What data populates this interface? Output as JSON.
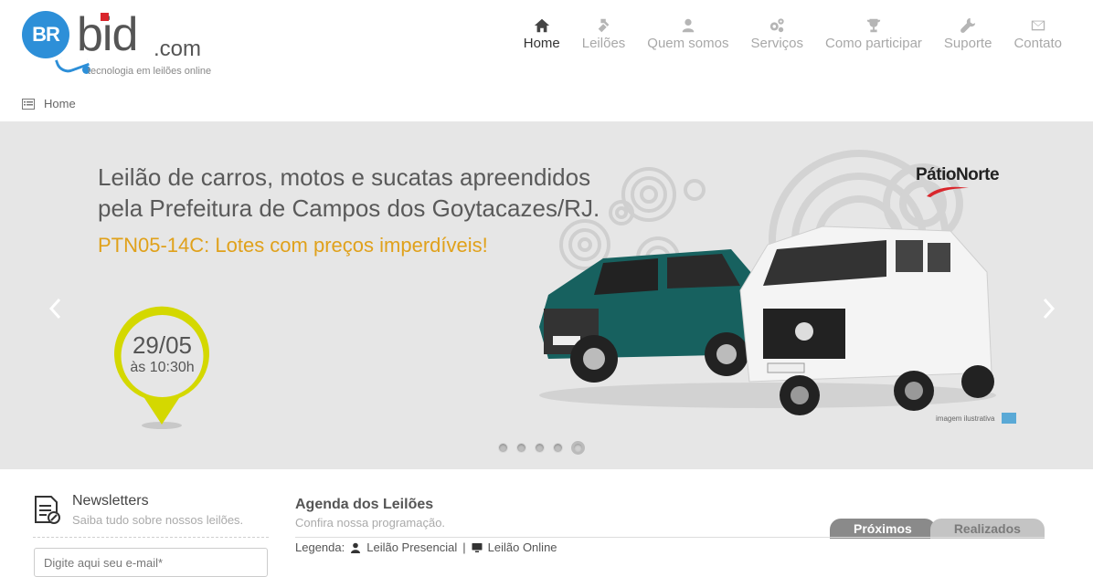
{
  "logo": {
    "br": "BR",
    "bid": "bid",
    "com": ".com",
    "tagline": "tecnologia em leilões online"
  },
  "nav": [
    {
      "label": "Home",
      "icon": "home-icon",
      "active": true
    },
    {
      "label": "Leilões",
      "icon": "gavel-icon"
    },
    {
      "label": "Quem somos",
      "icon": "user-icon"
    },
    {
      "label": "Serviços",
      "icon": "gears-icon"
    },
    {
      "label": "Como participar",
      "icon": "trophy-icon"
    },
    {
      "label": "Suporte",
      "icon": "wrench-icon"
    },
    {
      "label": "Contato",
      "icon": "envelope-icon"
    }
  ],
  "breadcrumb": {
    "label": "Home"
  },
  "banner": {
    "title_line1": "Leilão de carros, motos e sucatas apreendidos",
    "title_line2": "pela Prefeitura de Campos dos Goytacazes/RJ.",
    "subtitle": "PTN05-14C: Lotes com preços imperdíveis!",
    "date": "29/05",
    "time": "às 10:30h",
    "sponsor": "PátioNorte",
    "caption": "imagem ilustrativa",
    "slides": 5,
    "active_slide": 5,
    "accent_color": "#e0a11b",
    "pin_color": "#d4d800"
  },
  "newsletter": {
    "title": "Newsletters",
    "subtitle": "Saiba tudo sobre nossos leilões.",
    "placeholder": "Digite aqui seu e-mail*"
  },
  "agenda": {
    "title": "Agenda dos Leilões",
    "subtitle": "Confira nossa programação.",
    "legend_label": "Legenda:",
    "legend_presencial": "Leilão Presencial",
    "legend_separator": "|",
    "legend_online": "Leilão Online",
    "tab_next": "Próximos",
    "tab_done": "Realizados"
  }
}
